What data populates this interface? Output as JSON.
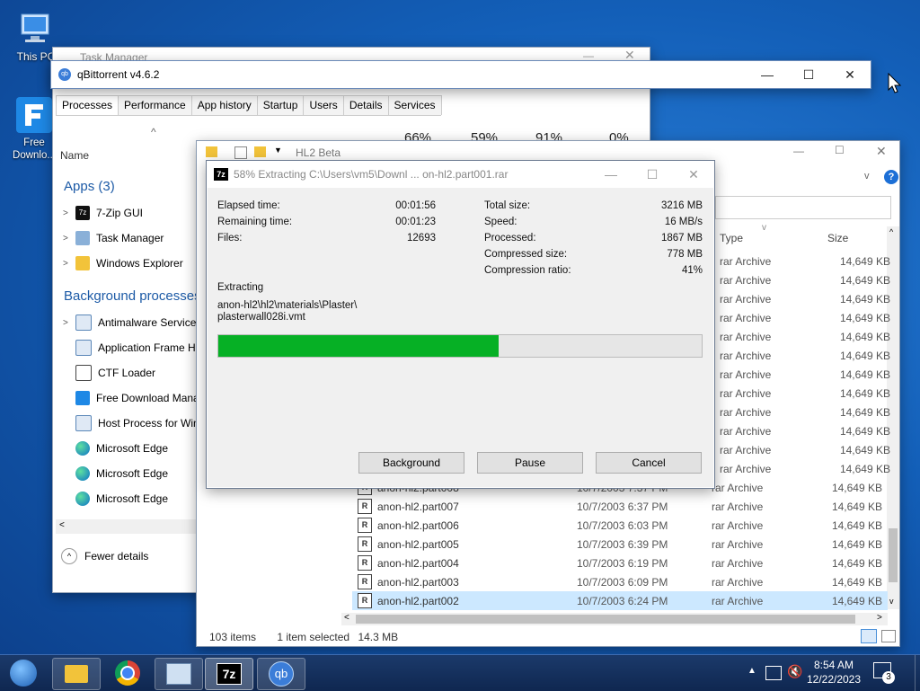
{
  "desktop": {
    "icons": [
      {
        "label": "This PC"
      },
      {
        "label": "Free Downlo..."
      }
    ]
  },
  "task_manager": {
    "title": "Task Manager",
    "tabs": [
      "Processes",
      "Performance",
      "App history",
      "Startup",
      "Users",
      "Details",
      "Services"
    ],
    "column_name": "Name",
    "stats": [
      "66%",
      "59%",
      "91%",
      "0%"
    ],
    "apps_header": "Apps (3)",
    "apps": [
      "7-Zip GUI",
      "Task Manager",
      "Windows Explorer"
    ],
    "bg_header": "Background processes",
    "background": [
      "Antimalware Service",
      "Application Frame H",
      "CTF Loader",
      "Free Download Mana",
      "Host Process for Win",
      "Microsoft Edge",
      "Microsoft Edge",
      "Microsoft Edge"
    ],
    "fewer_details": "Fewer details"
  },
  "qbittorrent": {
    "title": "qBittorrent v4.6.2",
    "icon": "qb"
  },
  "explorer": {
    "title": "HL2 Beta",
    "col_type": "Type",
    "col_size": "Size",
    "top_rows": [
      {
        "type": "rar Archive",
        "size": "14,649 KB"
      },
      {
        "type": "rar Archive",
        "size": "14,649 KB"
      },
      {
        "type": "rar Archive",
        "size": "14,649 KB"
      },
      {
        "type": "rar Archive",
        "size": "14,649 KB"
      },
      {
        "type": "rar Archive",
        "size": "14,649 KB"
      },
      {
        "type": "rar Archive",
        "size": "14,649 KB"
      },
      {
        "type": "rar Archive",
        "size": "14,649 KB"
      },
      {
        "type": "rar Archive",
        "size": "14,649 KB"
      },
      {
        "type": "rar Archive",
        "size": "14,649 KB"
      },
      {
        "type": "rar Archive",
        "size": "14,649 KB"
      },
      {
        "type": "rar Archive",
        "size": "14,649 KB"
      },
      {
        "type": "rar Archive",
        "size": "14,649 KB"
      }
    ],
    "rows": [
      {
        "name": "anon-hl2.part008",
        "date": "10/7/2003 7:37 PM",
        "type": "rar Archive",
        "size": "14,649 KB"
      },
      {
        "name": "anon-hl2.part007",
        "date": "10/7/2003 6:37 PM",
        "type": "rar Archive",
        "size": "14,649 KB"
      },
      {
        "name": "anon-hl2.part006",
        "date": "10/7/2003 6:03 PM",
        "type": "rar Archive",
        "size": "14,649 KB"
      },
      {
        "name": "anon-hl2.part005",
        "date": "10/7/2003 6:39 PM",
        "type": "rar Archive",
        "size": "14,649 KB"
      },
      {
        "name": "anon-hl2.part004",
        "date": "10/7/2003 6:19 PM",
        "type": "rar Archive",
        "size": "14,649 KB"
      },
      {
        "name": "anon-hl2.part003",
        "date": "10/7/2003 6:09 PM",
        "type": "rar Archive",
        "size": "14,649 KB"
      },
      {
        "name": "anon-hl2.part002",
        "date": "10/7/2003 6:24 PM",
        "type": "rar Archive",
        "size": "14,649 KB"
      }
    ],
    "status_items": "103 items",
    "status_selected": "1 item selected",
    "status_size": "14.3 MB"
  },
  "sevenzip": {
    "title": "58% Extracting C:\\Users\\vm5\\Downl ... on-hl2.part001.rar",
    "icon": "7z",
    "elapsed_label": "Elapsed time:",
    "elapsed": "00:01:56",
    "remaining_label": "Remaining time:",
    "remaining": "00:01:23",
    "files_label": "Files:",
    "files": "12693",
    "total_label": "Total size:",
    "total": "3216 MB",
    "speed_label": "Speed:",
    "speed": "16 MB/s",
    "processed_label": "Processed:",
    "processed": "1867 MB",
    "compressed_label": "Compressed size:",
    "compressed": "778 MB",
    "ratio_label": "Compression ratio:",
    "ratio": "41%",
    "extracting_label": "Extracting",
    "path_line1": "anon-hl2\\hl2\\materials\\Plaster\\",
    "path_line2": "plasterwall028i.vmt",
    "progress": 0.58,
    "progress_color": "#06b025",
    "btn_background": "Background",
    "btn_pause": "Pause",
    "btn_cancel": "Cancel"
  },
  "taskbar": {
    "time": "8:54 AM",
    "date": "12/22/2023",
    "notifications": "3",
    "sevenzip_icon": "7z",
    "qb_icon": "qb"
  }
}
